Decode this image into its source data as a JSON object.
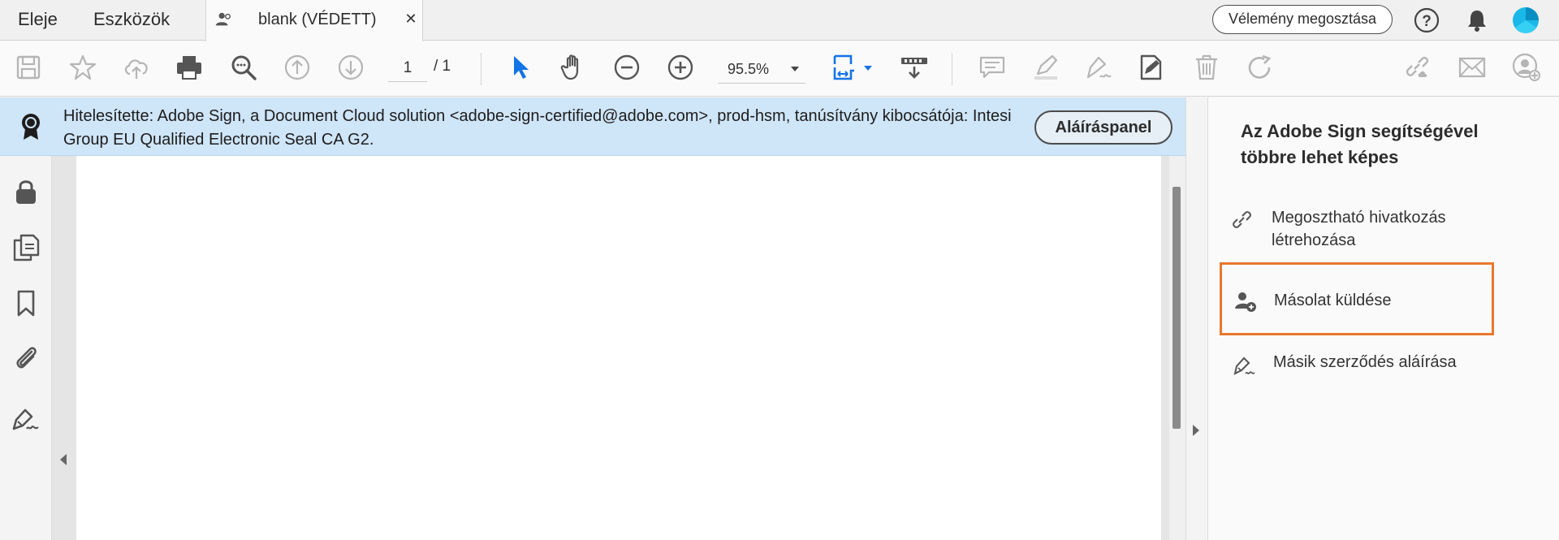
{
  "tabbar": {
    "home_label": "Eleje",
    "tools_label": "Eszközök",
    "doc_tab_title": "blank (VÉDETT)",
    "doc_tab_close": "✕",
    "feedback_label": "Vélemény megosztása",
    "help_icon": "help-icon",
    "bell_icon": "bell-icon",
    "avatar_color": "#1ab8e8"
  },
  "toolbar": {
    "page_current": "1",
    "page_total": "/ 1",
    "zoom": "95.5%",
    "accent_color": "#1473e6",
    "disabled_color": "#b5b5b5",
    "icons": [
      "save-icon",
      "star-icon",
      "cloud-upload-icon",
      "print-icon",
      "find-icon",
      "page-up-icon",
      "page-down-icon",
      "select-tool-icon",
      "hand-tool-icon",
      "zoom-out-icon",
      "zoom-in-icon",
      "page-fit-icon",
      "scroll-mode-icon",
      "comment-icon",
      "highlight-icon",
      "sign-icon",
      "fill-sign-icon",
      "delete-icon",
      "rotate-icon",
      "share-link-icon",
      "email-icon",
      "add-user-icon"
    ]
  },
  "banner": {
    "text": "Hitelesítette: Adobe Sign, a Document Cloud solution <adobe-sign-certified@adobe.com>, prod-hsm, tanúsítvány kibocsátója: Intesi Group EU Qualified Electronic Seal CA G2.",
    "button_label": "Aláíráspanel",
    "background": "#cfe5f8"
  },
  "left_nav": {
    "icons": [
      "lock-icon",
      "pages-icon",
      "bookmark-icon",
      "attachment-icon",
      "signature-icon"
    ]
  },
  "right_panel": {
    "title": "Az Adobe Sign segítségével többre lehet képes",
    "items": [
      {
        "label": "Megosztható hivatkozás létrehozása",
        "icon": "link-icon"
      },
      {
        "label": "Másolat küldése",
        "icon": "add-user-icon"
      },
      {
        "label": "Másik szerződés aláírása",
        "icon": "sign-pen-icon"
      }
    ],
    "highlight_color": "#e8782c"
  }
}
